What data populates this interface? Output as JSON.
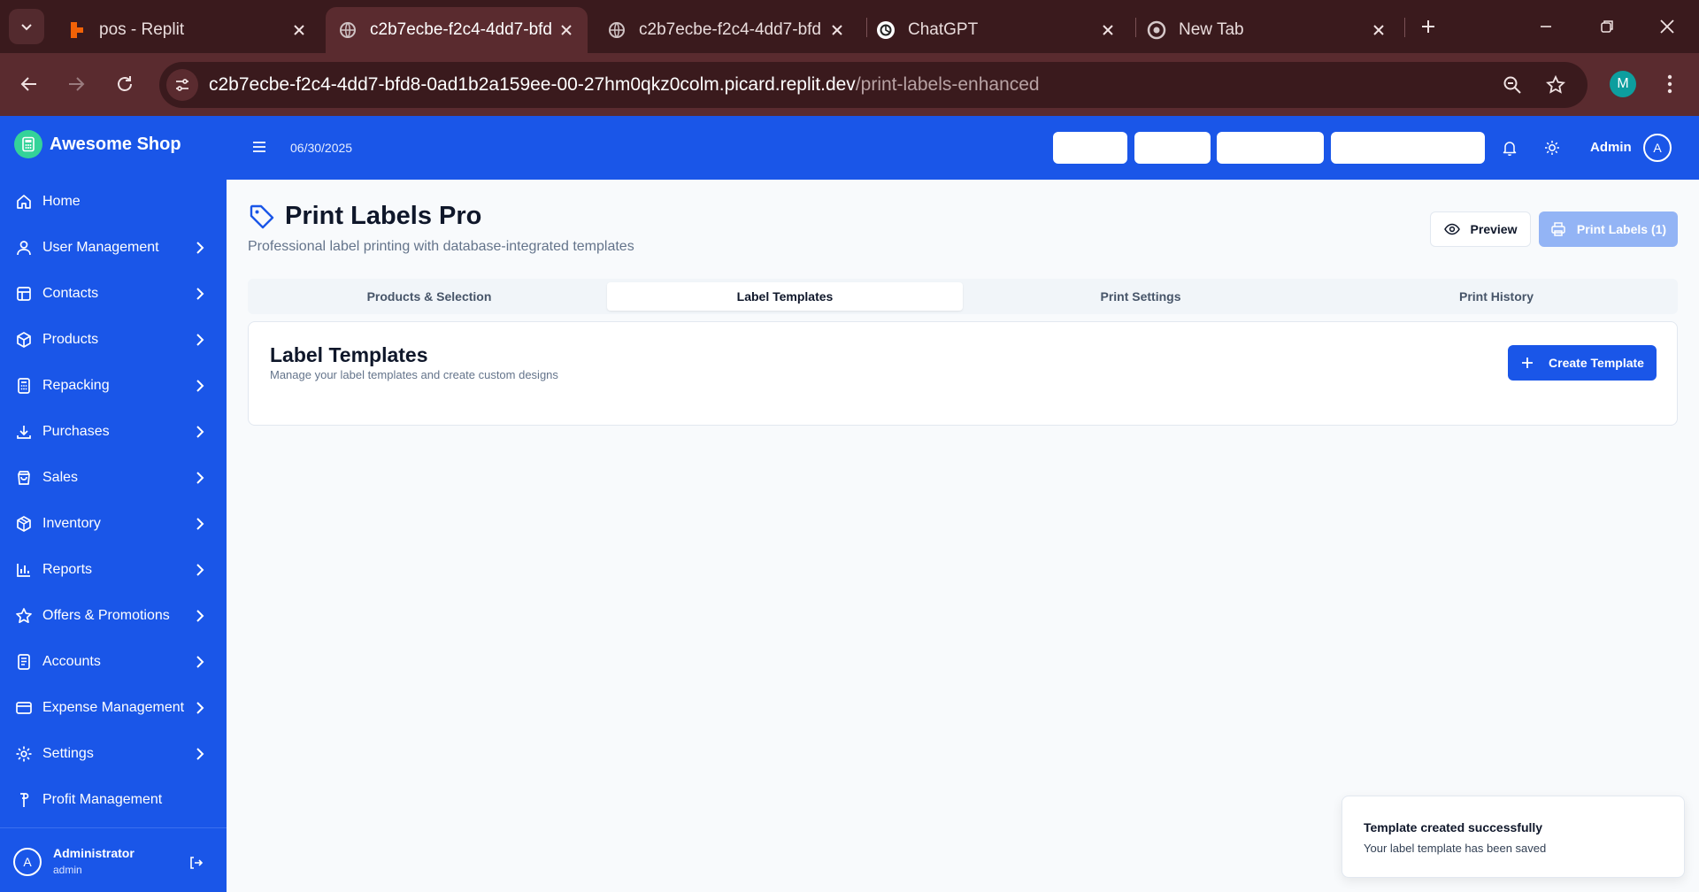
{
  "browser": {
    "tabs": [
      {
        "title": "pos - Replit",
        "favicon": "replit-icon",
        "active": false
      },
      {
        "title": "c2b7ecbe-f2c4-4dd7-bfd",
        "favicon": "globe-icon",
        "active": true
      },
      {
        "title": "c2b7ecbe-f2c4-4dd7-bfd",
        "favicon": "globe-icon",
        "active": false
      },
      {
        "title": "ChatGPT",
        "favicon": "chatgpt-icon",
        "active": false
      },
      {
        "title": "New Tab",
        "favicon": "chrome-icon",
        "active": false
      }
    ],
    "url_host": "c2b7ecbe-f2c4-4dd7-bfd8-0ad1b2a159ee-00-27hm0qkz0colm.picard.replit.dev",
    "url_path": "/print-labels-enhanced",
    "profile_initial": "M"
  },
  "sidebar": {
    "brand": "Awesome Shop",
    "items": [
      {
        "label": "Home",
        "icon": "home-icon",
        "has_children": false
      },
      {
        "label": "User Management",
        "icon": "user-icon",
        "has_children": true
      },
      {
        "label": "Contacts",
        "icon": "contacts-icon",
        "has_children": true
      },
      {
        "label": "Products",
        "icon": "box-icon",
        "has_children": true
      },
      {
        "label": "Repacking",
        "icon": "calculator-icon",
        "has_children": true
      },
      {
        "label": "Purchases",
        "icon": "download-icon",
        "has_children": true
      },
      {
        "label": "Sales",
        "icon": "shopping-bag-icon",
        "has_children": true
      },
      {
        "label": "Inventory",
        "icon": "package-icon",
        "has_children": true
      },
      {
        "label": "Reports",
        "icon": "bar-chart-icon",
        "has_children": true
      },
      {
        "label": "Offers & Promotions",
        "icon": "star-icon",
        "has_children": true
      },
      {
        "label": "Accounts",
        "icon": "receipt-icon",
        "has_children": true
      },
      {
        "label": "Expense Management",
        "icon": "wallet-icon",
        "has_children": true
      },
      {
        "label": "Settings",
        "icon": "gear-icon",
        "has_children": true
      },
      {
        "label": "Profit Management",
        "icon": "pin-icon",
        "has_children": false
      }
    ],
    "user": {
      "initial": "A",
      "name": "Administrator",
      "role": "admin"
    }
  },
  "header": {
    "date": "06/30/2025",
    "admin_label": "Admin",
    "admin_initial": "A"
  },
  "page": {
    "title": "Print Labels Pro",
    "subtitle": "Professional label printing with database-integrated templates",
    "preview_label": "Preview",
    "print_label": "Print Labels (1)",
    "tabs": [
      {
        "label": "Products & Selection",
        "active": false
      },
      {
        "label": "Label Templates",
        "active": true
      },
      {
        "label": "Print Settings",
        "active": false
      },
      {
        "label": "Print History",
        "active": false
      }
    ],
    "card": {
      "title": "Label Templates",
      "description": "Manage your label templates and create custom designs",
      "create_label": "Create Template"
    }
  },
  "toast": {
    "title": "Template created successfully",
    "description": "Your label template has been saved"
  },
  "colors": {
    "brand_blue": "#1a56e8",
    "browser_frame": "#3a1a1d",
    "browser_toolbar": "#5a2b2f",
    "brand_logo_green": "#34d399",
    "disabled_button": "#93b4f5"
  }
}
